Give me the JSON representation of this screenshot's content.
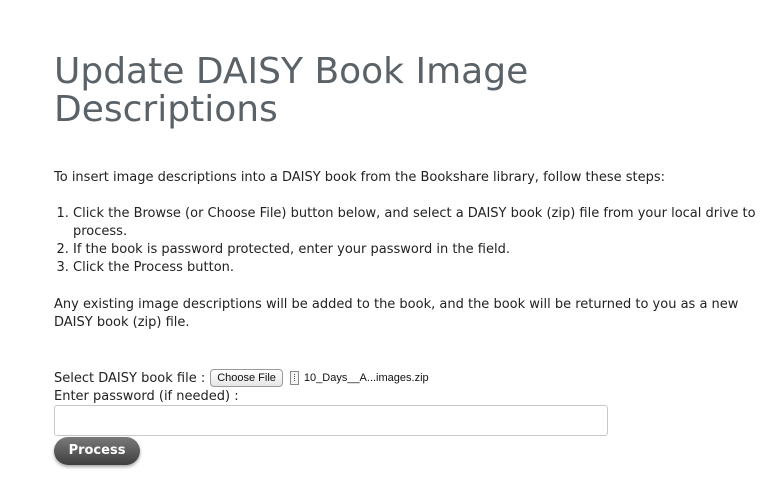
{
  "page": {
    "title": "Update DAISY Book Image Descriptions",
    "intro": "To insert image descriptions into a DAISY book from the Bookshare library, follow these steps:",
    "steps": [
      "Click the Browse (or Choose File) button below, and select a DAISY book (zip) file from your local drive to process.",
      "If the book is password protected, enter your password in the field.",
      "Click the Process button."
    ],
    "note": "Any existing image descriptions will be added to the book, and the book will be returned to you as a new DAISY book (zip) file."
  },
  "form": {
    "file_label": "Select DAISY book file :",
    "choose_button": "Choose File",
    "file_icon": "document-icon",
    "selected_file": "10_Days__A...images.zip",
    "password_label": "Enter password (if needed) :",
    "password_value": "",
    "process_button": "Process"
  },
  "colors": {
    "title": "#5a6268",
    "button_dark": "#3e3e3e"
  }
}
